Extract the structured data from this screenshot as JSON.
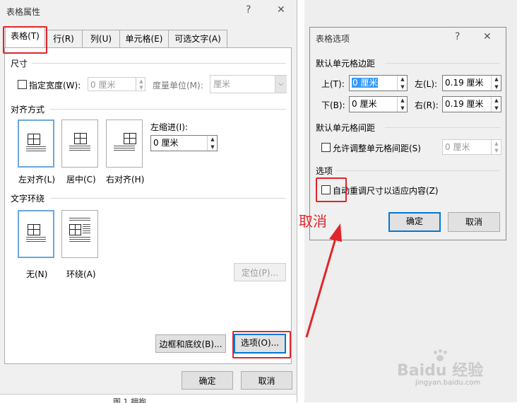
{
  "left_dialog": {
    "title": "表格属性",
    "help": "?",
    "close": "✕",
    "tabs": [
      "表格(T)",
      "行(R)",
      "列(U)",
      "单元格(E)",
      "可选文字(A)"
    ],
    "size_section": "尺寸",
    "preferred_width_label": "指定宽度(W):",
    "preferred_width_value": "0 厘米",
    "measure_label": "度量单位(M):",
    "measure_value": "厘米",
    "alignment_section": "对齐方式",
    "indent_label": "左缩进(I):",
    "indent_value": "0 厘米",
    "alignment_options": [
      "左对齐(L)",
      "居中(C)",
      "右对齐(H)"
    ],
    "wrap_section": "文字环绕",
    "wrap_options": [
      "无(N)",
      "环绕(A)"
    ],
    "positioning_button": "定位(P)...",
    "borders_button": "边框和底纹(B)...",
    "options_button": "选项(O)...",
    "ok_button": "确定",
    "cancel_button": "取消",
    "bottom_clip_text": "图 1 拥抱"
  },
  "right_dialog": {
    "title": "表格选项",
    "help": "?",
    "close": "✕",
    "margins_section": "默认单元格边距",
    "top_label": "上(T):",
    "top_value": "0 厘米",
    "left_label": "左(L):",
    "left_value": "0.19 厘米",
    "bottom_label": "下(B):",
    "bottom_value": "0 厘米",
    "right_label": "右(R):",
    "right_value": "0.19 厘米",
    "spacing_section": "默认单元格间距",
    "allow_spacing_label": "允许调整单元格间距(S)",
    "spacing_value": "0 厘米",
    "options_section": "选项",
    "autoresize_label": "自动重调尺寸以适应内容(Z)",
    "ok_button": "确定",
    "cancel_button": "取消"
  },
  "annotation": {
    "text": "取消",
    "color": "#e0262b"
  },
  "watermark": {
    "brand": "Baidu 经验",
    "url": "jingyan.baidu.com"
  }
}
